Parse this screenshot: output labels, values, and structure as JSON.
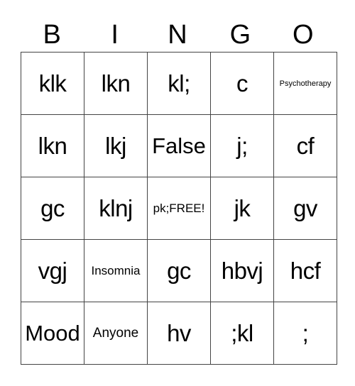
{
  "header": [
    "B",
    "I",
    "N",
    "G",
    "O"
  ],
  "rows": [
    [
      {
        "text": "klk",
        "size": "lg"
      },
      {
        "text": "lkn",
        "size": "lg"
      },
      {
        "text": "kl;",
        "size": "lg"
      },
      {
        "text": "c",
        "size": "lg"
      },
      {
        "text": "Psychotherapy",
        "size": "tiny"
      }
    ],
    [
      {
        "text": "lkn",
        "size": "lg"
      },
      {
        "text": "lkj",
        "size": "lg"
      },
      {
        "text": "False",
        "size": "md"
      },
      {
        "text": "j;",
        "size": "lg"
      },
      {
        "text": "cf",
        "size": "lg"
      }
    ],
    [
      {
        "text": "gc",
        "size": "lg"
      },
      {
        "text": "klnj",
        "size": "lg"
      },
      {
        "text": "pk;FREE!",
        "size": "xs"
      },
      {
        "text": "jk",
        "size": "lg"
      },
      {
        "text": "gv",
        "size": "lg"
      }
    ],
    [
      {
        "text": "vgj",
        "size": "lg"
      },
      {
        "text": "Insomnia",
        "size": "xs"
      },
      {
        "text": "gc",
        "size": "lg"
      },
      {
        "text": "hbvj",
        "size": "lg"
      },
      {
        "text": "hcf",
        "size": "lg"
      }
    ],
    [
      {
        "text": "Mood",
        "size": "md"
      },
      {
        "text": "Anyone",
        "size": "sm"
      },
      {
        "text": "hv",
        "size": "lg"
      },
      {
        "text": ";kl",
        "size": "lg"
      },
      {
        "text": ";",
        "size": "lg"
      }
    ]
  ]
}
